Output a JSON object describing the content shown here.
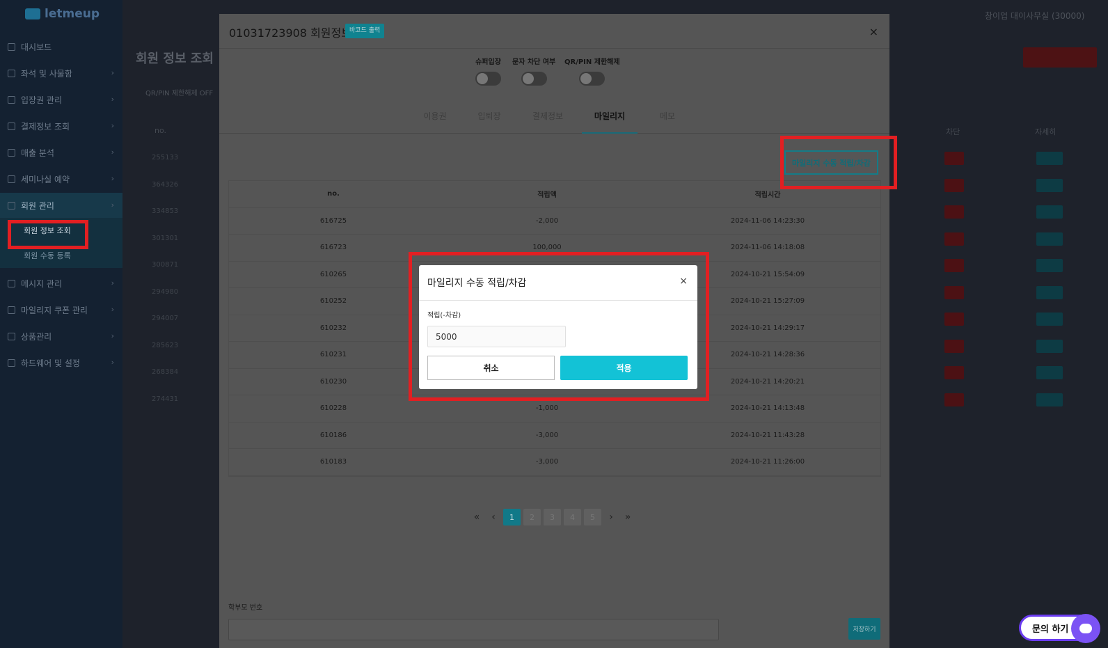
{
  "sidebar": {
    "logo": "letmeup",
    "items": [
      {
        "label": "대시보드",
        "icon": "dashboard-icon"
      },
      {
        "label": "좌석 및 사물함",
        "icon": "seat-icon"
      },
      {
        "label": "입장권 관리",
        "icon": "ticket-icon"
      },
      {
        "label": "결제정보 조회",
        "icon": "payment-icon"
      },
      {
        "label": "매출 분석",
        "icon": "chart-icon"
      },
      {
        "label": "세미나실 예약",
        "icon": "calendar-icon"
      },
      {
        "label": "회원 관리",
        "icon": "users-icon"
      },
      {
        "label": "메시지 관리",
        "icon": "message-icon"
      },
      {
        "label": "마일리지 쿠폰 관리",
        "icon": "coupon-icon"
      },
      {
        "label": "상품관리",
        "icon": "product-icon"
      },
      {
        "label": "하드웨어 및 설정",
        "icon": "settings-icon"
      }
    ],
    "sub_items": [
      "회원 정보 조회",
      "회원 수동 등록"
    ]
  },
  "background": {
    "title": "회원 정보 조회",
    "filter": "QR/PIN 제한해제 OFF",
    "store_name": "창이업 대이사무실 (30000)",
    "col_no": "no.",
    "col_block": "차단",
    "col_detail": "자세히",
    "row_ids": [
      "255133",
      "364326",
      "334853",
      "301301",
      "300871",
      "294980",
      "294007",
      "285623",
      "268384",
      "274431"
    ]
  },
  "modal": {
    "title": "01031723908 회원정보",
    "barcode_badge": "바코드 출력",
    "close": "×",
    "toggles": [
      "슈퍼입장",
      "문자 차단 여부",
      "QR/PIN 제한해제"
    ],
    "tabs": [
      "이용권",
      "입퇴장",
      "결제정보",
      "마일리지",
      "메모"
    ],
    "active_tab": "마일리지",
    "manual_button": "마일리지 수동 적립/차감",
    "table": {
      "headers": [
        "no.",
        "적립액",
        "적립시간"
      ],
      "rows": [
        {
          "no": "616725",
          "amount": "-2,000",
          "time": "2024-11-06 14:23:30"
        },
        {
          "no": "616723",
          "amount": "100,000",
          "time": "2024-11-06 14:18:08"
        },
        {
          "no": "610265",
          "amount": "",
          "time": "2024-10-21 15:54:09"
        },
        {
          "no": "610252",
          "amount": "",
          "time": "2024-10-21 15:27:09"
        },
        {
          "no": "610232",
          "amount": "",
          "time": "2024-10-21 14:29:17"
        },
        {
          "no": "610231",
          "amount": "",
          "time": "2024-10-21 14:28:36"
        },
        {
          "no": "610230",
          "amount": "",
          "time": "2024-10-21 14:20:21"
        },
        {
          "no": "610228",
          "amount": "-1,000",
          "time": "2024-10-21 14:13:48"
        },
        {
          "no": "610186",
          "amount": "-3,000",
          "time": "2024-10-21 11:43:28"
        },
        {
          "no": "610183",
          "amount": "-3,000",
          "time": "2024-10-21 11:26:00"
        }
      ]
    },
    "pagination": {
      "pages": [
        "1",
        "2",
        "3",
        "4",
        "5"
      ],
      "current": "1",
      "first": "«",
      "prev": "‹",
      "next": "›",
      "last": "»"
    },
    "parent_label": "학부모 번호",
    "save_button": "저장하기"
  },
  "dialog": {
    "title": "마일리지 수동 적립/차감",
    "close": "×",
    "label": "적립(-차감)",
    "input_value": "5000",
    "cancel": "취소",
    "apply": "적용"
  },
  "inquiry": {
    "label": "문의 하기"
  },
  "colors": {
    "accent": "#13c2d6",
    "highlight": "#e21f22",
    "inquiry": "#6b3cf0"
  }
}
